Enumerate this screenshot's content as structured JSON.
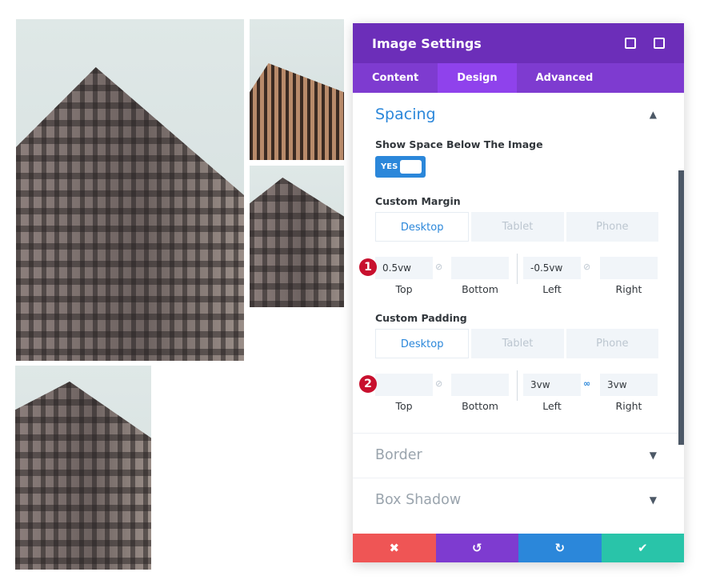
{
  "photos": [
    "building-photo-1",
    "building-photo-2",
    "building-photo-3",
    "building-photo-4"
  ],
  "panel": {
    "title": "Image Settings",
    "header_icons": [
      "fullscreen-icon",
      "sidebar-layout-icon"
    ],
    "tabs": [
      {
        "label": "Content"
      },
      {
        "label": "Design",
        "active": true
      },
      {
        "label": "Advanced"
      }
    ],
    "spacing": {
      "title": "Spacing",
      "show_space_label": "Show Space Below The Image",
      "toggle_label": "YES",
      "toggle_on": true,
      "margin": {
        "label": "Custom Margin",
        "devices": [
          "Desktop",
          "Tablet",
          "Phone"
        ],
        "badge": "1",
        "top": "0.5vw",
        "bottom": "",
        "left": "-0.5vw",
        "right": "",
        "linked_tb": false,
        "linked_lr": false
      },
      "padding": {
        "label": "Custom Padding",
        "devices": [
          "Desktop",
          "Tablet",
          "Phone"
        ],
        "badge": "2",
        "top": "",
        "bottom": "",
        "left": "3vw",
        "right": "3vw",
        "linked_tb": false,
        "linked_lr": true
      },
      "captions": {
        "top": "Top",
        "bottom": "Bottom",
        "left": "Left",
        "right": "Right"
      }
    },
    "sections": [
      {
        "title": "Border"
      },
      {
        "title": "Box Shadow"
      }
    ],
    "footer": {
      "cancel": "✖",
      "undo": "↺",
      "redo": "↻",
      "save": "✔"
    },
    "colors": {
      "header": "#6c2eb9",
      "tabs": "#7e3bd0",
      "accent": "#2b87da",
      "cancel": "#ef5555",
      "undo": "#7e3bd0",
      "redo": "#2b87da",
      "save": "#29c4a9"
    }
  }
}
